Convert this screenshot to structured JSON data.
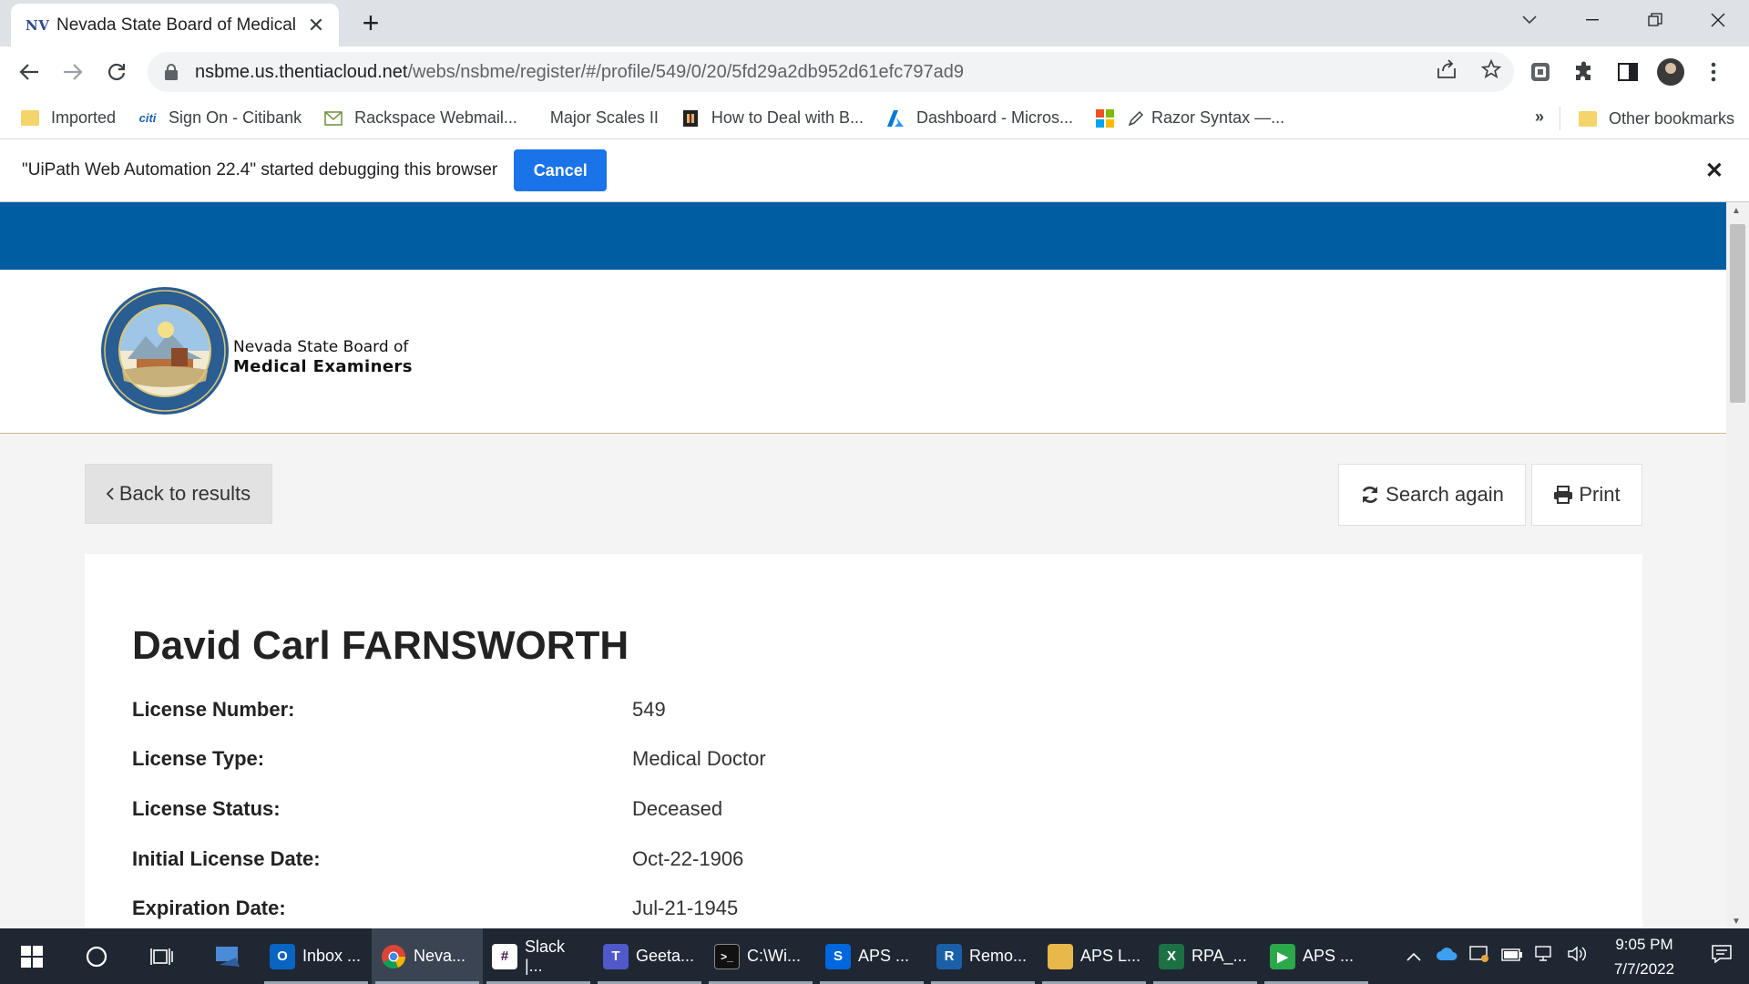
{
  "browser": {
    "tab": {
      "favicon_text": "NV",
      "title": "Nevada State Board of Medical E"
    },
    "url": {
      "host": "nsbme.us.thentiacloud.net",
      "path": "/webs/nsbme/register/#/profile/549/0/20/5fd29a2db952d61efc797ad9"
    },
    "bookmarks": [
      {
        "label": "Imported",
        "icon": "folder-icon"
      },
      {
        "label": "Sign On - Citibank",
        "icon": "citi-icon"
      },
      {
        "label": "Rackspace Webmail...",
        "icon": "mail-icon"
      },
      {
        "label": "Major Scales II",
        "icon": "blank-icon"
      },
      {
        "label": "How to Deal with B...",
        "icon": "book-icon"
      },
      {
        "label": "Dashboard - Micros...",
        "icon": "azure-icon"
      },
      {
        "label": "Razor Syntax —...",
        "icon": "microsoft-icon"
      }
    ],
    "bookmarks_more": "»",
    "other_bookmarks": "Other bookmarks",
    "infobar": {
      "message": "\"UiPath Web Automation 22.4\" started debugging this browser",
      "cancel_label": "Cancel"
    }
  },
  "site": {
    "brand_line1": "Nevada State Board of",
    "brand_line2": "Medical Examiners",
    "back_label": "Back to results",
    "search_again_label": "Search again",
    "print_label": "Print"
  },
  "profile": {
    "name": "David Carl FARNSWORTH",
    "fields": [
      {
        "label": "License Number:",
        "value": "549"
      },
      {
        "label": "License Type:",
        "value": "Medical Doctor"
      },
      {
        "label": "License Status:",
        "value": "Deceased"
      },
      {
        "label": "Initial License Date:",
        "value": "Oct-22-1906"
      },
      {
        "label": "Expiration Date:",
        "value": "Jul-21-1945"
      }
    ]
  },
  "taskbar": {
    "apps": [
      {
        "label": "Inbox ...",
        "icon": "outlook-icon",
        "color": "#0a64c2",
        "glyph": "O"
      },
      {
        "label": "Neva...",
        "icon": "chrome-icon",
        "color": "#db4437",
        "glyph": "",
        "active": true
      },
      {
        "label": "Slack |...",
        "icon": "slack-icon",
        "color": "#4a154b",
        "glyph": "#"
      },
      {
        "label": "Geeta...",
        "icon": "teams-icon",
        "color": "#5059c9",
        "glyph": "T"
      },
      {
        "label": "C:\\Wi...",
        "icon": "cmd-icon",
        "color": "#111111",
        "glyph": ">_"
      },
      {
        "label": "APS ...",
        "icon": "uipath-studio-icon",
        "color": "#0067df",
        "glyph": "S"
      },
      {
        "label": "Remo...",
        "icon": "remote-desktop-icon",
        "color": "#1b5fa8",
        "glyph": "R"
      },
      {
        "label": "APS L...",
        "icon": "file-explorer-icon",
        "color": "#e8b84a",
        "glyph": ""
      },
      {
        "label": "RPA_...",
        "icon": "excel-icon",
        "color": "#1d7044",
        "glyph": "X"
      },
      {
        "label": "APS ...",
        "icon": "uipath-assistant-icon",
        "color": "#2aa84a",
        "glyph": "▶"
      }
    ],
    "time": "9:05 PM",
    "date": "7/7/2022"
  }
}
